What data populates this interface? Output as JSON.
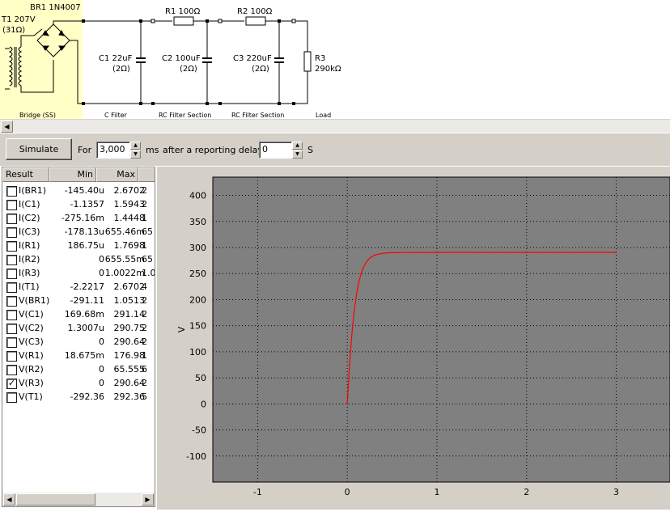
{
  "schematic": {
    "br1_label": "BR1 1N4007",
    "t1_label": "T1 207V",
    "t1_resistance": "(31Ω)",
    "r1_label": "R1 100Ω",
    "r2_label": "R2 100Ω",
    "c1_label": "C1 22uF",
    "c1_esr": "(2Ω)",
    "c2_label": "C2 100uF",
    "c2_esr": "(2Ω)",
    "c3_label": "C3 220uF",
    "c3_esr": "(2Ω)",
    "r3_label": "R3",
    "r3_value": "290kΩ",
    "section_bridge": "Bridge (SS)",
    "section_c_filter": "C Filter",
    "section_rc1": "RC Filter Section",
    "section_rc2": "RC Filter Section",
    "section_load": "Load",
    "highlight_color": "#ffffc6"
  },
  "toolbar": {
    "simulate_label": "Simulate",
    "for_label": "For",
    "duration_value": "3,000",
    "ms_label": "ms",
    "delay_label": "after a reporting delay of",
    "delay_value": "0",
    "s_label": "S"
  },
  "results": {
    "columns": [
      "Result",
      "Min",
      "Max"
    ],
    "rows": [
      {
        "name": "I(BR1)",
        "min": "-145.40u",
        "max": "2.6702",
        "extra": "2",
        "checked": false
      },
      {
        "name": "I(C1)",
        "min": "-1.1357",
        "max": "1.5943",
        "extra": "2",
        "checked": false
      },
      {
        "name": "I(C2)",
        "min": "-275.16m",
        "max": "1.4448",
        "extra": "1",
        "checked": false
      },
      {
        "name": "I(C3)",
        "min": "-178.13u",
        "max": "655.46m",
        "extra": "65",
        "checked": false
      },
      {
        "name": "I(R1)",
        "min": "186.75u",
        "max": "1.7698",
        "extra": "1",
        "checked": false
      },
      {
        "name": "I(R2)",
        "min": "0",
        "max": "655.55m",
        "extra": "65",
        "checked": false
      },
      {
        "name": "I(R3)",
        "min": "0",
        "max": "1.0022m",
        "extra": "1.0",
        "checked": false
      },
      {
        "name": "I(T1)",
        "min": "-2.2217",
        "max": "2.6702",
        "extra": "4",
        "checked": false
      },
      {
        "name": "V(BR1)",
        "min": "-291.11",
        "max": "1.0513",
        "extra": "2",
        "checked": false
      },
      {
        "name": "V(C1)",
        "min": "169.68m",
        "max": "291.14",
        "extra": "2",
        "checked": false
      },
      {
        "name": "V(C2)",
        "min": "1.3007u",
        "max": "290.75",
        "extra": "2",
        "checked": false
      },
      {
        "name": "V(C3)",
        "min": "0",
        "max": "290.64",
        "extra": "2",
        "checked": false
      },
      {
        "name": "V(R1)",
        "min": "18.675m",
        "max": "176.98",
        "extra": "1",
        "checked": false
      },
      {
        "name": "V(R2)",
        "min": "0",
        "max": "65.555",
        "extra": "6",
        "checked": false
      },
      {
        "name": "V(R3)",
        "min": "0",
        "max": "290.64",
        "extra": "2",
        "checked": true
      },
      {
        "name": "V(T1)",
        "min": "-292.36",
        "max": "292.36",
        "extra": "5",
        "checked": false
      }
    ]
  },
  "chart_data": {
    "type": "line",
    "ylabel": "V",
    "xlim": [
      -1.5,
      3.6
    ],
    "ylim": [
      -150,
      435
    ],
    "x_ticks": [
      -1,
      0,
      1,
      2,
      3
    ],
    "y_ticks": [
      -100,
      -50,
      0,
      50,
      100,
      150,
      200,
      250,
      300,
      350,
      400
    ],
    "grid": true,
    "line_color": "#ff0000",
    "plot_background": "#808080",
    "series": [
      {
        "x": [
          0,
          0.02,
          0.04,
          0.06,
          0.08,
          0.1,
          0.12,
          0.15,
          0.18,
          0.22,
          0.26,
          0.3,
          0.35,
          0.4,
          0.5,
          0.6,
          0.8,
          1.0,
          1.5,
          2.0,
          2.5,
          3.0
        ],
        "y": [
          0,
          60,
          110,
          150,
          182,
          207,
          227,
          248,
          262,
          274,
          281,
          285,
          287.5,
          289,
          290,
          290.4,
          290.6,
          290.64,
          290.64,
          290.64,
          290.64,
          290.64
        ]
      }
    ]
  }
}
